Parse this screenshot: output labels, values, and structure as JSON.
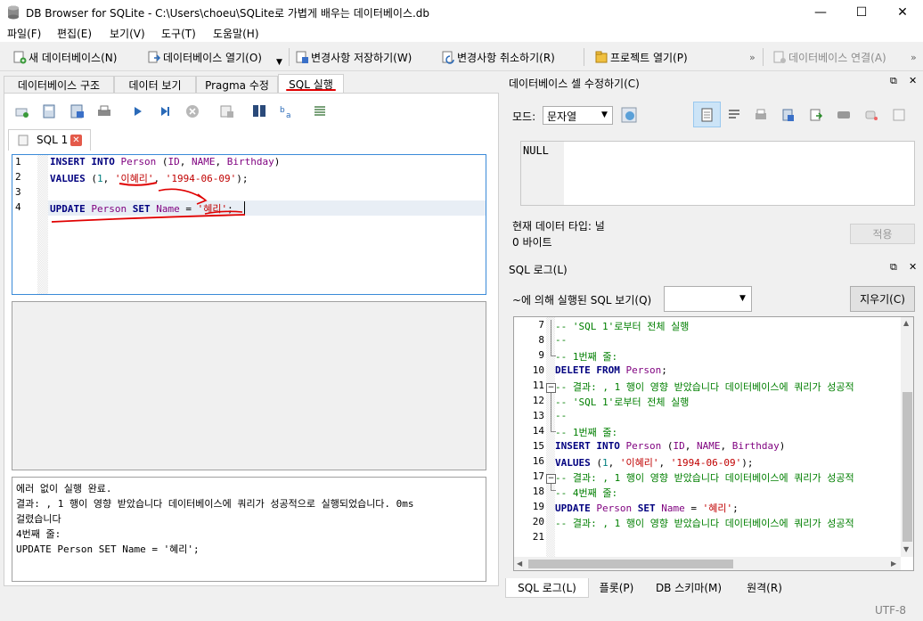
{
  "window": {
    "title": "DB Browser for SQLite - C:\\Users\\choeu\\SQLite로 가볍게 배우는 데이터베이스.db",
    "minimize": "—",
    "maximize": "☐",
    "close": "✕"
  },
  "menu": [
    "파일(F)",
    "편집(E)",
    "보기(V)",
    "도구(T)",
    "도움말(H)"
  ],
  "toolbar": {
    "new_db": "새 데이터베이스(N)",
    "open_db": "데이터베이스 열기(O)",
    "write_changes": "변경사항 저장하기(W)",
    "revert_changes": "변경사항 취소하기(R)",
    "open_project": "프로젝트 열기(P)",
    "attach_db": "데이터베이스 연결(A)",
    "overflow": "»"
  },
  "main_tabs": [
    "데이터베이스 구조",
    "데이터 보기",
    "Pragma 수정",
    "SQL 실행"
  ],
  "sql_tab": {
    "label": "SQL 1"
  },
  "editor": {
    "line_numbers": [
      "1",
      "2",
      "3",
      "4"
    ],
    "lines": [
      [
        {
          "t": "INSERT",
          "c": "kw"
        },
        {
          "t": " ",
          "c": "plain"
        },
        {
          "t": "INTO",
          "c": "kw"
        },
        {
          "t": " ",
          "c": "plain"
        },
        {
          "t": "Person",
          "c": "id"
        },
        {
          "t": " (",
          "c": "plain"
        },
        {
          "t": "ID",
          "c": "id"
        },
        {
          "t": ", ",
          "c": "plain"
        },
        {
          "t": "NAME",
          "c": "id"
        },
        {
          "t": ", ",
          "c": "plain"
        },
        {
          "t": "Birthday",
          "c": "id"
        },
        {
          "t": ")",
          "c": "plain"
        }
      ],
      [
        {
          "t": "VALUES",
          "c": "kw"
        },
        {
          "t": " (",
          "c": "plain"
        },
        {
          "t": "1",
          "c": "num"
        },
        {
          "t": ", ",
          "c": "plain"
        },
        {
          "t": "'이혜리'",
          "c": "str"
        },
        {
          "t": ", ",
          "c": "plain"
        },
        {
          "t": "'1994-06-09'",
          "c": "str"
        },
        {
          "t": ");",
          "c": "plain"
        }
      ],
      [],
      [
        {
          "t": "UPDATE",
          "c": "kw"
        },
        {
          "t": " ",
          "c": "plain"
        },
        {
          "t": "Person",
          "c": "id"
        },
        {
          "t": " ",
          "c": "plain"
        },
        {
          "t": "SET",
          "c": "kw"
        },
        {
          "t": " ",
          "c": "plain"
        },
        {
          "t": "Name",
          "c": "id"
        },
        {
          "t": " = ",
          "c": "plain"
        },
        {
          "t": "'혜리'",
          "c": "str"
        },
        {
          "t": ";",
          "c": "plain"
        }
      ]
    ]
  },
  "message_pane": {
    "line1": "에러 없이 실행 완료.",
    "line2": "결과: , 1 행이 영향 받았습니다 데이터베이스에 쿼리가 성공적으로 실행되었습니다. 0ms",
    "line3": "걸렸습니다",
    "line4": "4번째 줄:",
    "line5": "UPDATE Person SET Name = '혜리';"
  },
  "cell_editor": {
    "title": "데이터베이스 셀 수정하기(C)",
    "mode_label": "모드:",
    "mode_value": "문자열",
    "value": "NULL",
    "type_label": "현재 데이터 타입: 널",
    "size_label": "0 바이트",
    "apply": "적용"
  },
  "sql_log": {
    "title": "SQL 로그(L)",
    "filter_label": "~에 의해 실행된 SQL 보기(Q)",
    "clear": "지우기(C)",
    "line_numbers": [
      "7",
      "8",
      "9",
      "10",
      "11",
      "12",
      "13",
      "14",
      "15",
      "16",
      "17",
      "18",
      "19",
      "20",
      "21"
    ],
    "lines": [
      [
        {
          "t": "-- 'SQL 1'로부터 전체 실행",
          "c": "cm"
        }
      ],
      [
        {
          "t": "--",
          "c": "cm"
        }
      ],
      [
        {
          "t": "-- 1번째 줄:",
          "c": "cm"
        }
      ],
      [
        {
          "t": "DELETE",
          "c": "kw"
        },
        {
          "t": " ",
          "c": "plain"
        },
        {
          "t": "FROM",
          "c": "kw"
        },
        {
          "t": " ",
          "c": "plain"
        },
        {
          "t": "Person",
          "c": "id"
        },
        {
          "t": ";",
          "c": "plain"
        }
      ],
      [
        {
          "t": "-- 결과: , 1 행이 영향 받았습니다 데이터베이스에 쿼리가 성공적",
          "c": "cm"
        }
      ],
      [
        {
          "t": "-- 'SQL 1'로부터 전체 실행",
          "c": "cm"
        }
      ],
      [
        {
          "t": "--",
          "c": "cm"
        }
      ],
      [
        {
          "t": "-- 1번째 줄:",
          "c": "cm"
        }
      ],
      [
        {
          "t": "INSERT",
          "c": "kw"
        },
        {
          "t": " ",
          "c": "plain"
        },
        {
          "t": "INTO",
          "c": "kw"
        },
        {
          "t": " ",
          "c": "plain"
        },
        {
          "t": "Person",
          "c": "id"
        },
        {
          "t": " (",
          "c": "plain"
        },
        {
          "t": "ID",
          "c": "id"
        },
        {
          "t": ", ",
          "c": "plain"
        },
        {
          "t": "NAME",
          "c": "id"
        },
        {
          "t": ", ",
          "c": "plain"
        },
        {
          "t": "Birthday",
          "c": "id"
        },
        {
          "t": ")",
          "c": "plain"
        }
      ],
      [
        {
          "t": "VALUES",
          "c": "kw"
        },
        {
          "t": " (",
          "c": "plain"
        },
        {
          "t": "1",
          "c": "num"
        },
        {
          "t": ", ",
          "c": "plain"
        },
        {
          "t": "'이혜리'",
          "c": "str"
        },
        {
          "t": ", ",
          "c": "plain"
        },
        {
          "t": "'1994-06-09'",
          "c": "str"
        },
        {
          "t": ");",
          "c": "plain"
        }
      ],
      [
        {
          "t": "-- 결과: , 1 행이 영향 받았습니다 데이터베이스에 쿼리가 성공적",
          "c": "cm"
        }
      ],
      [
        {
          "t": "-- 4번째 줄:",
          "c": "cm"
        }
      ],
      [
        {
          "t": "UPDATE",
          "c": "kw"
        },
        {
          "t": " ",
          "c": "plain"
        },
        {
          "t": "Person",
          "c": "id"
        },
        {
          "t": " ",
          "c": "plain"
        },
        {
          "t": "SET",
          "c": "kw"
        },
        {
          "t": " ",
          "c": "plain"
        },
        {
          "t": "Name",
          "c": "id"
        },
        {
          "t": " = ",
          "c": "plain"
        },
        {
          "t": "'혜리'",
          "c": "str"
        },
        {
          "t": ";",
          "c": "plain"
        }
      ],
      [
        {
          "t": "-- 결과: , 1 행이 영향 받았습니다 데이터베이스에 쿼리가 성공적",
          "c": "cm"
        }
      ],
      []
    ]
  },
  "bottom_tabs": [
    "SQL 로그(L)",
    "플롯(P)",
    "DB 스키마(M)",
    "원격(R)"
  ],
  "status": {
    "encoding": "UTF-8"
  },
  "colors": {
    "keyword": "#00007f",
    "identifier": "#7f007f",
    "string": "#c00000",
    "number": "#007f7f",
    "comment": "#007f00",
    "annotation": "#e00000",
    "focus": "#3a8ad8"
  }
}
